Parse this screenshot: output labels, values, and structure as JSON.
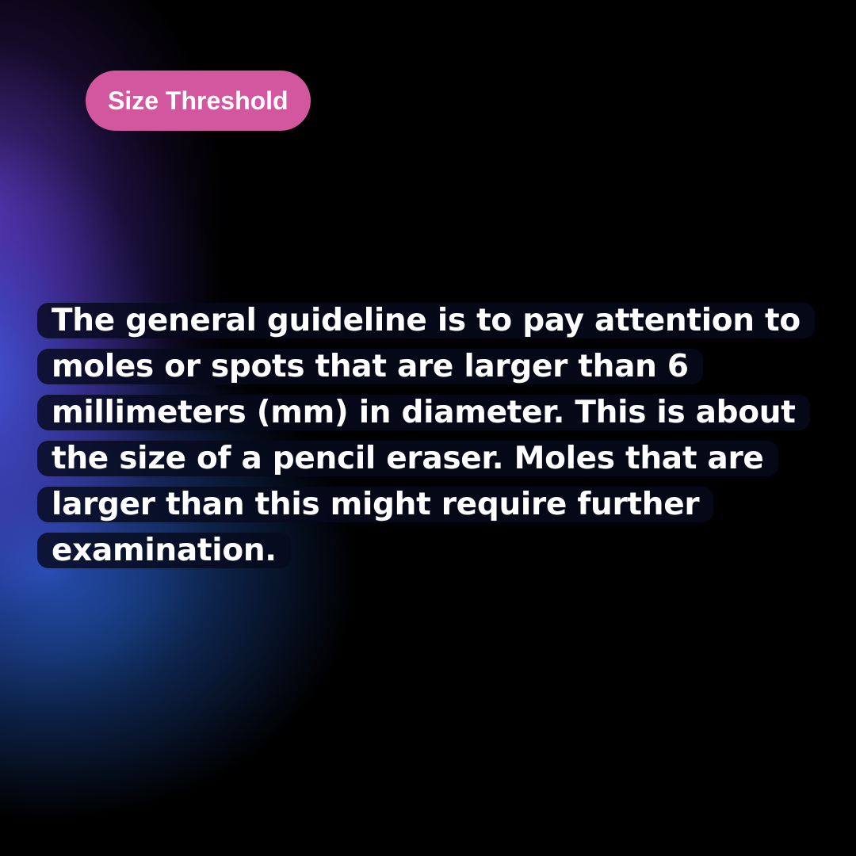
{
  "tag": {
    "label": "Size Threshold",
    "color": "#d2579f"
  },
  "body": {
    "text": "The general guideline is to pay attention to moles or spots that are larger than 6 millimeters (mm) in diameter. This is about the size of a pencil eraser. Moles that are larger than this might require further examination."
  },
  "theme": {
    "background": "#000000",
    "glow_colors": [
      "#4a5ae6",
      "#6a3cc8",
      "#2a6ee6"
    ],
    "text_color": "#ffffff"
  }
}
